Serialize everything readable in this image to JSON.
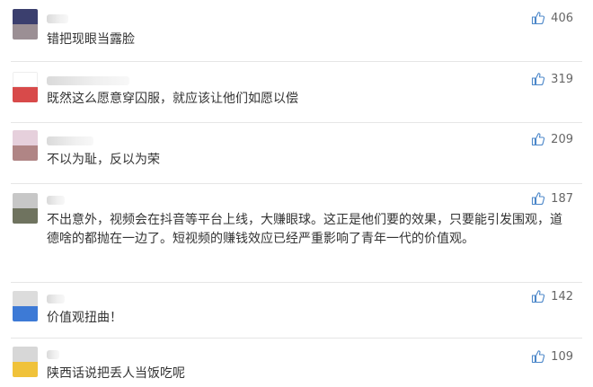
{
  "comments": [
    {
      "text": "错把现眼当露脸",
      "likes": "406",
      "avatar_colors": [
        "#3b3f6e",
        "#9b8f94"
      ]
    },
    {
      "text": "既然这么愿意穿囚服，就应该让他们如愿以偿",
      "likes": "319",
      "avatar_colors": [
        "#ffffff",
        "#d84a4a"
      ]
    },
    {
      "text": "不以为耻，反以为荣",
      "likes": "209",
      "avatar_colors": [
        "#e6d0dc",
        "#b08585"
      ]
    },
    {
      "text": "不出意外，视频会在抖音等平台上线，大赚眼球。这正是他们要的效果，只要能引发围观，道德啥的都抛在一边了。短视频的赚钱效应已经严重影响了青年一代的价值观。",
      "likes": "187",
      "avatar_colors": [
        "#c7c7c7",
        "#6f735f"
      ]
    },
    {
      "text": "价值观扭曲！",
      "likes": "142",
      "avatar_colors": [
        "#dcdcdc",
        "#3d7ad6"
      ]
    },
    {
      "text": "陕西话说把丢人当饭吃呢",
      "likes": "109",
      "avatar_colors": [
        "#d7d7d7",
        "#f0c23a"
      ]
    }
  ],
  "like_icon": "thumbs-up-icon",
  "like_color": "#4c87c9"
}
